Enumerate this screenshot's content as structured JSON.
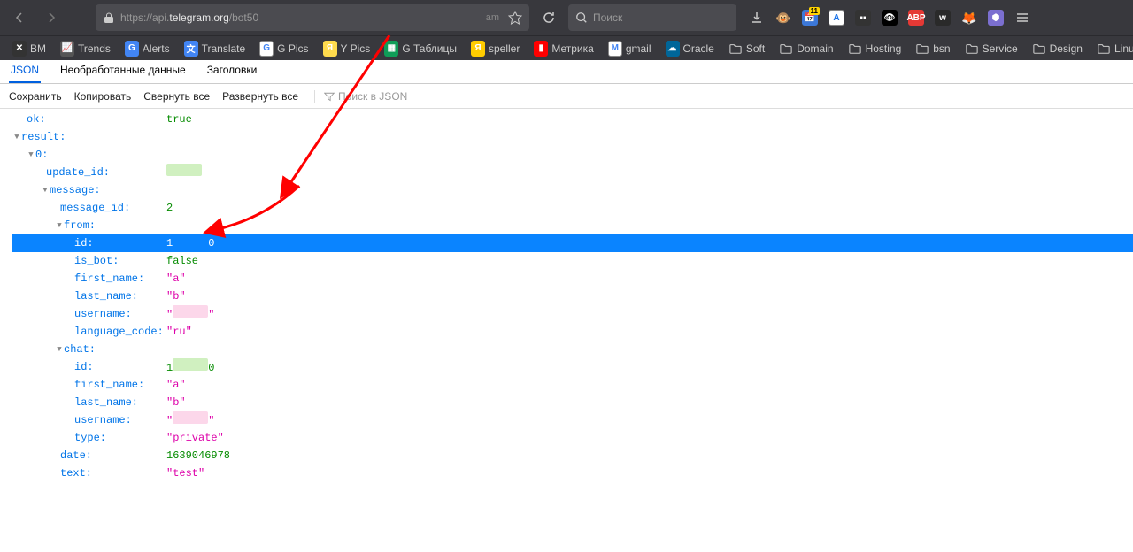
{
  "toolbar": {
    "url_prefix": "https://api.",
    "url_host": "telegram.org",
    "url_path": "/bot50",
    "url_hint": "am",
    "search_placeholder": "Поиск"
  },
  "bookmarks": [
    {
      "label": "BM",
      "iconBg": "#333",
      "iconTxt": "✕"
    },
    {
      "label": "Trends",
      "iconBg": "#555",
      "iconTxt": "📈"
    },
    {
      "label": "Alerts",
      "iconBg": "#4285f4",
      "iconTxt": "G"
    },
    {
      "label": "Translate",
      "iconBg": "#4285f4",
      "iconTxt": "文"
    },
    {
      "label": "G Pics",
      "iconBg": "#fff",
      "iconTxt": "G"
    },
    {
      "label": "Y Pics",
      "iconBg": "#ffdb4d",
      "iconTxt": "Я"
    },
    {
      "label": "G Таблицы",
      "iconBg": "#0f9d58",
      "iconTxt": "▦"
    },
    {
      "label": "speller",
      "iconBg": "#ffcc00",
      "iconTxt": "Я"
    },
    {
      "label": "Метрика",
      "iconBg": "#ff0000",
      "iconTxt": "▮"
    },
    {
      "label": "gmail",
      "iconBg": "#fff",
      "iconTxt": "M"
    },
    {
      "label": "Oracle",
      "iconBg": "#006699",
      "iconTxt": "☁"
    },
    {
      "label": "Soft",
      "folder": true
    },
    {
      "label": "Domain",
      "folder": true
    },
    {
      "label": "Hosting",
      "folder": true
    },
    {
      "label": "bsn",
      "folder": true
    },
    {
      "label": "Service",
      "folder": true
    },
    {
      "label": "Design",
      "folder": true
    },
    {
      "label": "Linux",
      "folder": true
    }
  ],
  "viewer": {
    "tabs": {
      "json": "JSON",
      "raw": "Необработанные данные",
      "headers": "Заголовки"
    },
    "actions": {
      "save": "Сохранить",
      "copy": "Копировать",
      "collapse": "Свернуть все",
      "expand": "Развернуть все"
    },
    "filter_placeholder": "Поиск в JSON"
  },
  "json": {
    "ok_key": "ok:",
    "ok_val": "true",
    "result_key": "result:",
    "zero_key": "0:",
    "update_id_key": "update_id:",
    "message_key": "message:",
    "message_id_key": "message_id:",
    "message_id_val": "2",
    "from_key": "from:",
    "from_id_key": "id:",
    "from_id_val_a": "1",
    "from_id_val_b": "0",
    "is_bot_key": "is_bot:",
    "is_bot_val": "false",
    "first_name_key": "first_name:",
    "first_name_val": "\"a\"",
    "last_name_key": "last_name:",
    "last_name_val": "\"b\"",
    "username_key": "username:",
    "language_code_key": "language_code:",
    "language_code_val": "\"ru\"",
    "chat_key": "chat:",
    "chat_id_key": "id:",
    "chat_id_val_a": "1",
    "chat_id_val_b": "0",
    "chat_first_name_key": "first_name:",
    "chat_first_name_val": "\"a\"",
    "chat_last_name_key": "last_name:",
    "chat_last_name_val": "\"b\"",
    "chat_username_key": "username:",
    "type_key": "type:",
    "type_val": "\"private\"",
    "date_key": "date:",
    "date_val": "1639046978",
    "text_key": "text:",
    "text_val": "\"test\""
  }
}
